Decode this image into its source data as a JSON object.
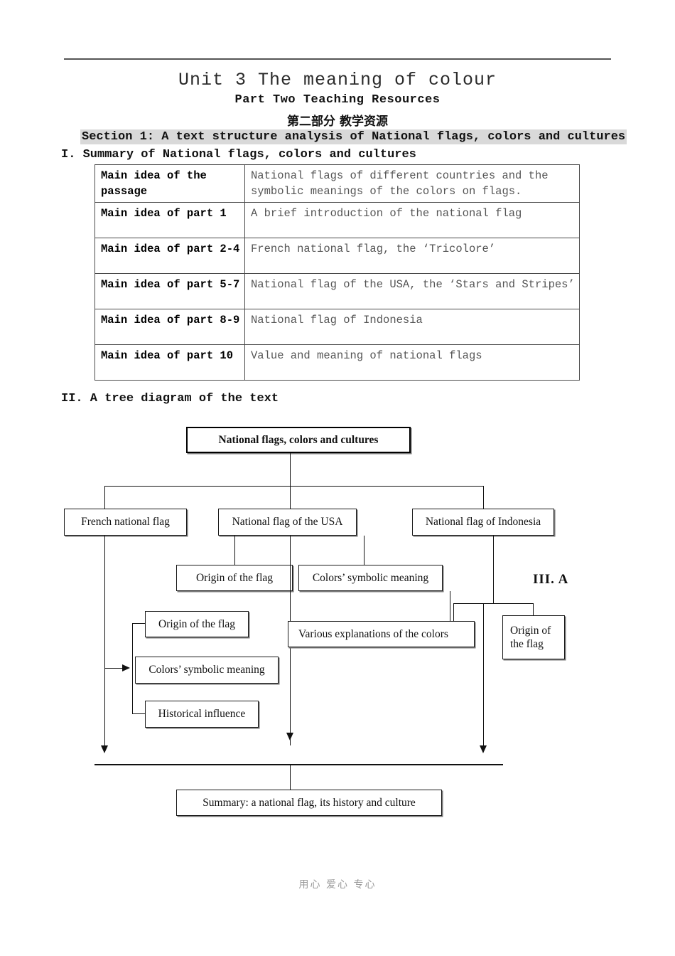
{
  "document": {
    "title_main": "Unit 3 The meaning of colour",
    "title_sub": "Part Two Teaching Resources",
    "title_cn": "第二部分  教学资源",
    "section_bar": "Section 1: A text structure analysis of National flags, colors and cultures",
    "footer": "用心 爱心 专心"
  },
  "sections": {
    "heading_i": "I. Summary of National flags, colors and cultures",
    "heading_ii": "II. A tree diagram of the text",
    "label_iii": "III. A"
  },
  "summary_table": {
    "rows": [
      {
        "key": "Main idea of the passage",
        "value": "National flags of different countries and the symbolic meanings of the colors on flags."
      },
      {
        "key": "Main idea of part 1",
        "value": "A brief introduction of the national flag"
      },
      {
        "key": "Main idea of part 2-4",
        "value": "French national flag, the ‘Tricolore’"
      },
      {
        "key": "Main idea of part 5-7",
        "value": "National flag of the USA, the ‘Stars and Stripes’"
      },
      {
        "key": "Main idea of part 8-9",
        "value": "National flag of Indonesia"
      },
      {
        "key": "Main idea of part 10",
        "value": "Value and meaning of national flags"
      }
    ]
  },
  "tree": {
    "root": "National flags, colors and cultures",
    "branch_france": "French national flag",
    "branch_usa": "National flag of the USA",
    "branch_indonesia": "National flag of Indonesia",
    "usa_origin": "Origin of the flag",
    "usa_colors": "Colors’ symbolic meaning",
    "usa_various": "Various explanations of the colors",
    "france_origin": "Origin of the flag",
    "france_colors": "Colors’ symbolic meaning",
    "france_historical": "Historical influence",
    "indonesia_origin": "Origin of the flag",
    "summary": "Summary: a national flag, its history and culture"
  },
  "colors": {
    "highlight": "#d9d9d9",
    "rule": "#555555",
    "table_text": "#555555",
    "ink": "#111111"
  }
}
